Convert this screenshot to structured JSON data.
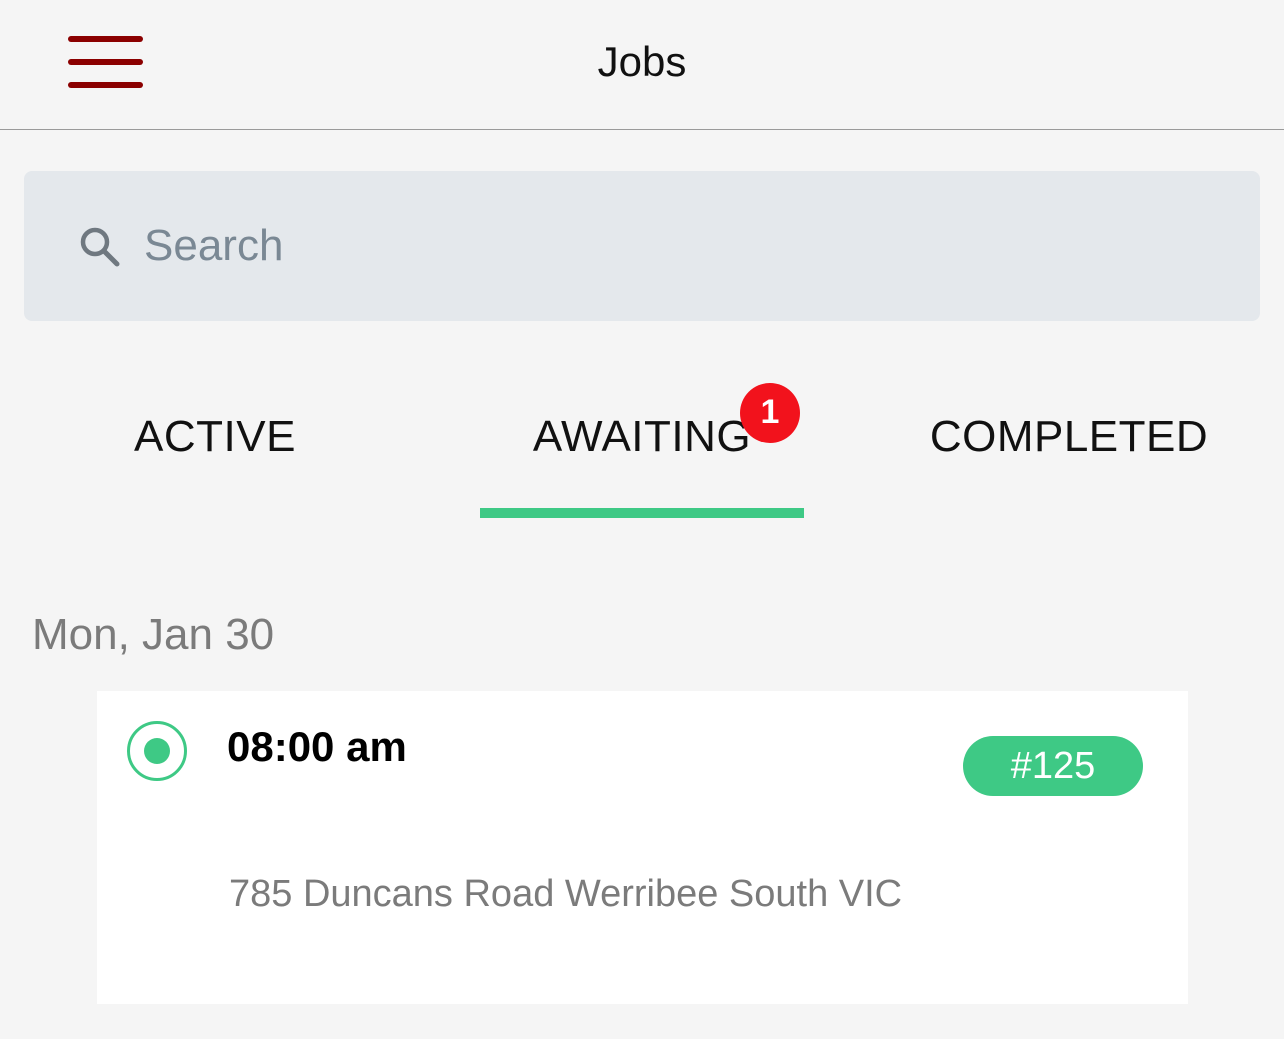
{
  "header": {
    "title": "Jobs",
    "menu_icon": "hamburger-menu-icon",
    "menu_color": "#8b0000"
  },
  "search": {
    "placeholder": "Search",
    "value": "",
    "icon": "search-icon"
  },
  "tabs": [
    {
      "label": "ACTIVE",
      "selected": false
    },
    {
      "label": "AWAITING",
      "selected": true,
      "badge": "1"
    },
    {
      "label": "COMPLETED",
      "selected": false
    }
  ],
  "colors": {
    "accent": "#3ec985",
    "badge": "#f2121c",
    "background": "#f5f5f5"
  },
  "sections": [
    {
      "date": "Mon, Jan 30",
      "jobs": [
        {
          "time": "08:00 am",
          "number": "#125",
          "address": "785 Duncans Road Werribee South VIC",
          "status_icon": "radio-selected-icon"
        }
      ]
    }
  ]
}
